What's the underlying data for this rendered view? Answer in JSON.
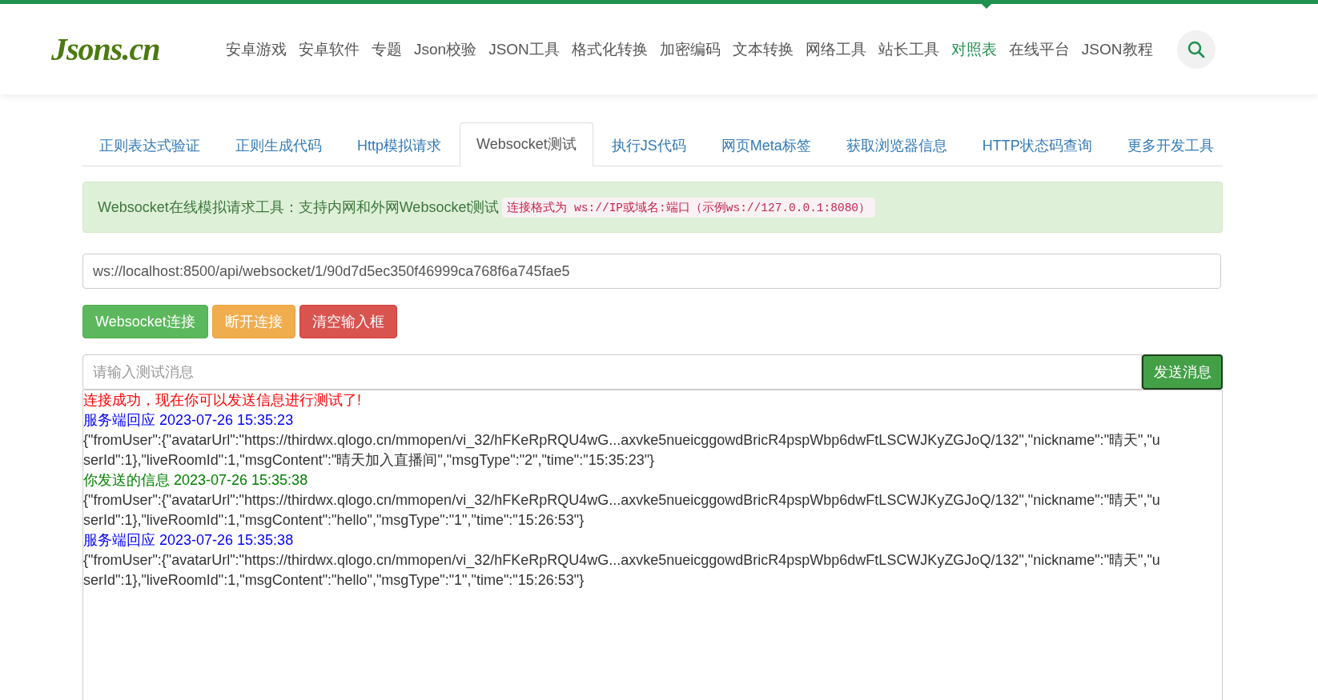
{
  "header": {
    "logo": "Jsons.cn",
    "nav": [
      {
        "label": "安卓游戏",
        "selected": false
      },
      {
        "label": "安卓软件",
        "selected": false
      },
      {
        "label": "专题",
        "selected": false
      },
      {
        "label": "Json校验",
        "selected": false
      },
      {
        "label": "JSON工具",
        "selected": false
      },
      {
        "label": "格式化转换",
        "selected": false
      },
      {
        "label": "加密编码",
        "selected": false
      },
      {
        "label": "文本转换",
        "selected": false
      },
      {
        "label": "网络工具",
        "selected": false
      },
      {
        "label": "站长工具",
        "selected": false
      },
      {
        "label": "对照表",
        "selected": true
      },
      {
        "label": "在线平台",
        "selected": false
      },
      {
        "label": "JSON教程",
        "selected": false
      }
    ]
  },
  "tabs": [
    {
      "label": "正则表达式验证",
      "selected": false
    },
    {
      "label": "正则生成代码",
      "selected": false
    },
    {
      "label": "Http模拟请求",
      "selected": false
    },
    {
      "label": "Websocket测试",
      "selected": true
    },
    {
      "label": "执行JS代码",
      "selected": false
    },
    {
      "label": "网页Meta标签",
      "selected": false
    },
    {
      "label": "获取浏览器信息",
      "selected": false
    },
    {
      "label": "HTTP状态码查询",
      "selected": false
    },
    {
      "label": "更多开发工具",
      "selected": false
    }
  ],
  "notice": {
    "text": "Websocket在线模拟请求工具：支持内网和外网Websocket测试",
    "code": "连接格式为 ws://IP或域名:端口（示例ws://127.0.0.1:8080）"
  },
  "url_field": {
    "value": "ws://localhost:8500/api/websocket/1/90d7d5ec350f46999ca768f6a745fae5"
  },
  "buttons": [
    {
      "label": "Websocket连接",
      "kind": "success"
    },
    {
      "label": "断开连接",
      "kind": "warning"
    },
    {
      "label": "清空输入框",
      "kind": "danger"
    }
  ],
  "message_field": {
    "placeholder": "请输入测试消息"
  },
  "send_button": {
    "label": "发送消息"
  },
  "log": [
    {
      "kind": "status",
      "text": "连接成功，现在你可以发送信息进行测试了!"
    },
    {
      "kind": "received",
      "text": "服务端回应 2023-07-26 15:35:23"
    },
    {
      "kind": "body",
      "text": "{\"fromUser\":{\"avatarUrl\":\"https://thirdwx.qlogo.cn/mmopen/vi_32/hFKeRpRQU4wG...axvke5nueicggowdBricR4pspWbp6dwFtLSCWJKyZGJoQ/132\",\"nickname\":\"晴天\",\"userId\":1},\"liveRoomId\":1,\"msgContent\":\"晴天加入直播间\",\"msgType\":\"2\",\"time\":\"15:35:23\"}"
    },
    {
      "kind": "sent",
      "text": "你发送的信息 2023-07-26 15:35:38"
    },
    {
      "kind": "body",
      "text": "{\"fromUser\":{\"avatarUrl\":\"https://thirdwx.qlogo.cn/mmopen/vi_32/hFKeRpRQU4wG...axvke5nueicggowdBricR4pspWbp6dwFtLSCWJKyZGJoQ/132\",\"nickname\":\"晴天\",\"userId\":1},\"liveRoomId\":1,\"msgContent\":\"hello\",\"msgType\":\"1\",\"time\":\"15:26:53\"}"
    },
    {
      "kind": "received",
      "text": "服务端回应 2023-07-26 15:35:38"
    },
    {
      "kind": "body",
      "text": "{\"fromUser\":{\"avatarUrl\":\"https://thirdwx.qlogo.cn/mmopen/vi_32/hFKeRpRQU4wG...axvke5nueicggowdBricR4pspWbp6dwFtLSCWJKyZGJoQ/132\",\"nickname\":\"晴天\",\"userId\":1},\"liveRoomId\":1,\"msgContent\":\"hello\",\"msgType\":\"1\",\"time\":\"15:26:53\"}"
    }
  ]
}
